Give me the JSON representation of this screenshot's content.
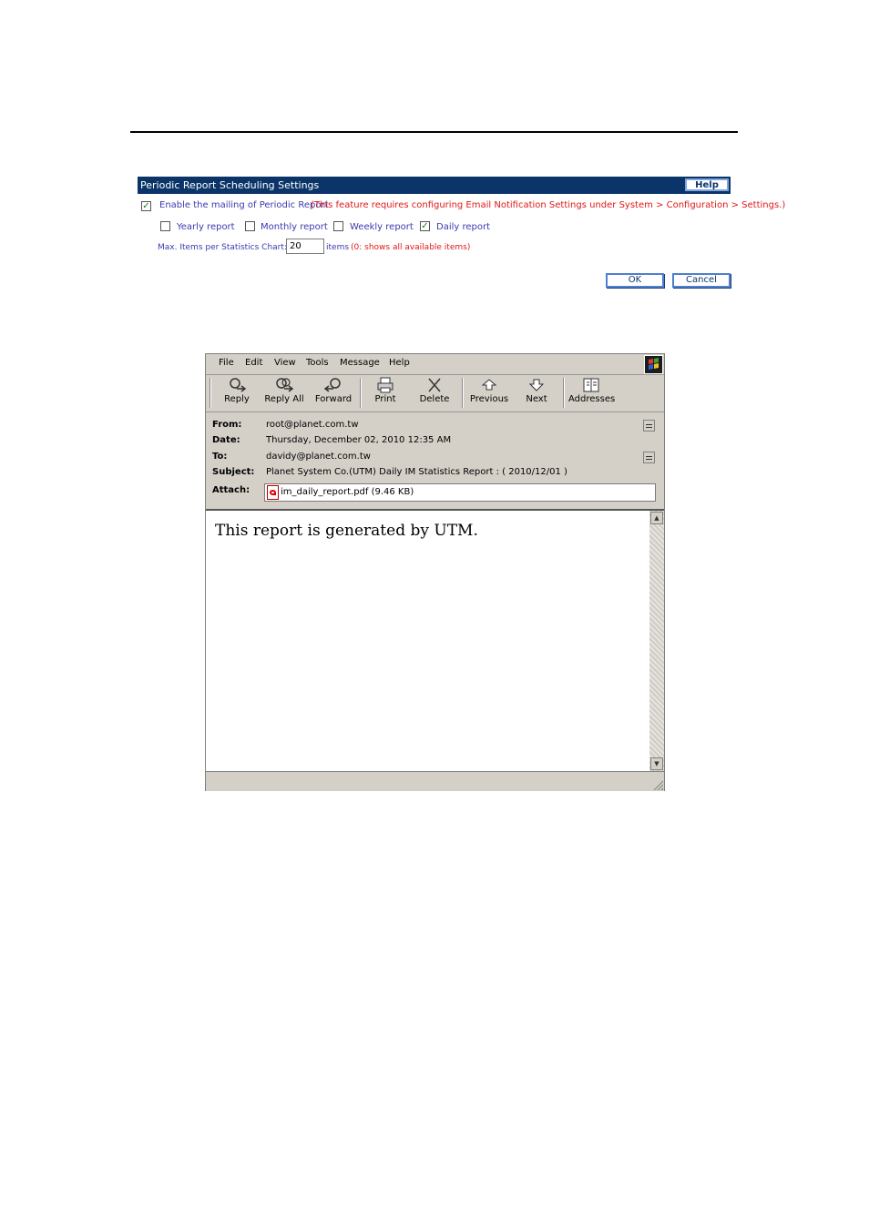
{
  "settings": {
    "title": "Periodic Report Scheduling Settings",
    "help_label": "Help",
    "enable_label": "Enable the mailing of Periodic Report",
    "enable_note": "(This feature requires configuring Email Notification Settings under System > Configuration > Settings.)",
    "enable_checked": true,
    "options": [
      {
        "label": "Yearly report",
        "checked": false
      },
      {
        "label": "Monthly report",
        "checked": false
      },
      {
        "label": "Weekly report",
        "checked": false
      },
      {
        "label": "Daily report",
        "checked": true
      }
    ],
    "max_items_label": "Max. Items per Statistics Chart:",
    "max_items_value": "20",
    "items_label": "items",
    "max_items_note": "(0: shows all available items)",
    "ok_label": "OK",
    "cancel_label": "Cancel"
  },
  "mail": {
    "menu": [
      "File",
      "Edit",
      "View",
      "Tools",
      "Message",
      "Help"
    ],
    "toolbar": [
      {
        "label": "Reply",
        "icon": "reply-icon"
      },
      {
        "label": "Reply All",
        "icon": "reply-all-icon"
      },
      {
        "label": "Forward",
        "icon": "forward-icon"
      },
      {
        "label": "Print",
        "icon": "print-icon"
      },
      {
        "label": "Delete",
        "icon": "delete-icon"
      },
      {
        "label": "Previous",
        "icon": "previous-icon"
      },
      {
        "label": "Next",
        "icon": "next-icon"
      },
      {
        "label": "Addresses",
        "icon": "addresses-icon"
      }
    ],
    "headers": {
      "from_label": "From:",
      "from": "root@planet.com.tw",
      "date_label": "Date:",
      "date": "Thursday, December 02, 2010 12:35 AM",
      "to_label": "To:",
      "to": "davidy@planet.com.tw",
      "subject_label": "Subject:",
      "subject": "Planet System Co.(UTM) Daily IM Statistics Report : ( 2010/12/01 )",
      "attach_label": "Attach:",
      "attachment": "im_daily_report.pdf (9.46 KB)"
    },
    "body": "This report is generated by UTM."
  }
}
